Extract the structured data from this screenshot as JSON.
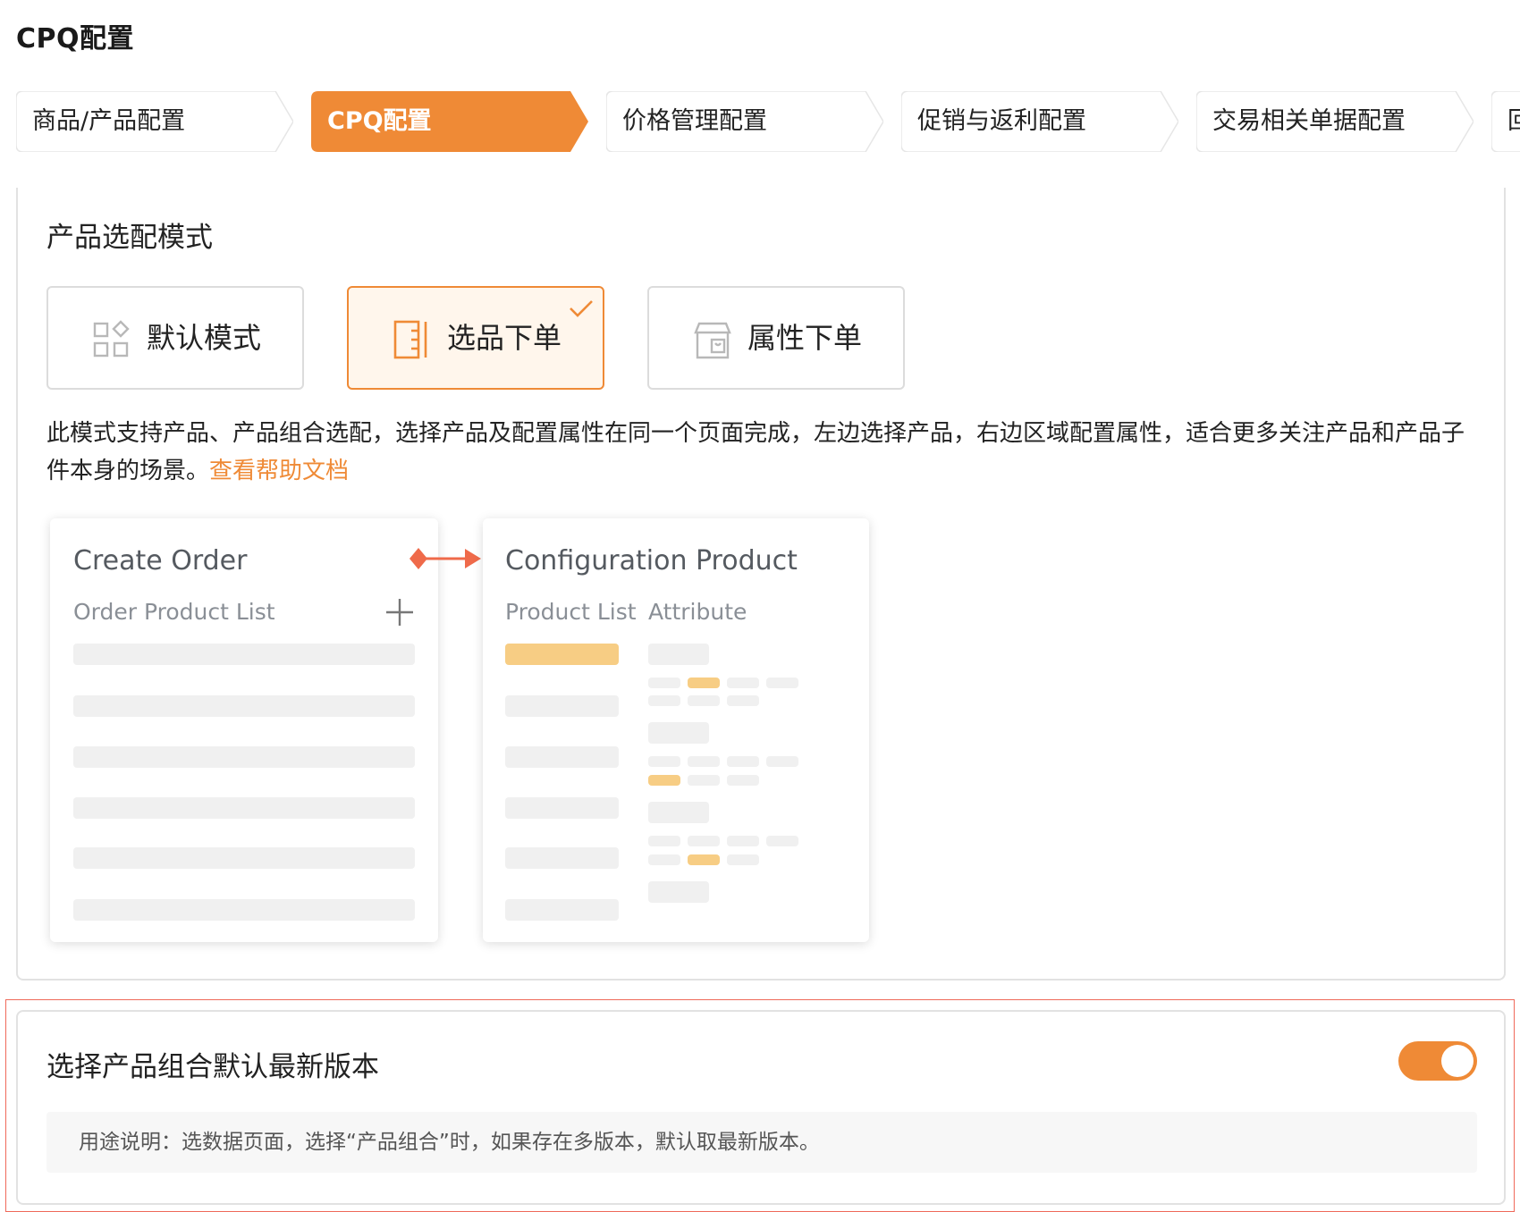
{
  "page_title": "CPQ配置",
  "steps": [
    {
      "label": "商品/产品配置",
      "active": false
    },
    {
      "label": "CPQ配置",
      "active": true
    },
    {
      "label": "价格管理配置",
      "active": false
    },
    {
      "label": "促销与返利配置",
      "active": false
    },
    {
      "label": "交易相关单据配置",
      "active": false
    },
    {
      "label": "回",
      "active": false
    }
  ],
  "selection_mode": {
    "title": "产品选配模式",
    "options": [
      {
        "label": "默认模式",
        "icon": "grid-icon",
        "selected": false
      },
      {
        "label": "选品下单",
        "icon": "list-panel-icon",
        "selected": true
      },
      {
        "label": "属性下单",
        "icon": "store-bag-icon",
        "selected": false
      }
    ],
    "description": "此模式支持产品、产品组合选配，选择产品及配置属性在同一个页面完成，左边选择产品，右边区域配置属性，适合更多关注产品和产品子件本身的场景。",
    "help_link": "查看帮助文档"
  },
  "illustration": {
    "left": {
      "title": "Create Order",
      "subtitle": "Order Product List"
    },
    "right": {
      "title": "Configuration Product",
      "tab_products": "Product List",
      "tab_attributes": "Attribute"
    }
  },
  "latest_version": {
    "title": "选择产品组合默认最新版本",
    "enabled": true,
    "usage": "用途说明：选数据页面，选择“产品组合”时，如果存在多版本，默认取最新版本。"
  },
  "colors": {
    "accent": "#ef8a36",
    "highlight_bar": "#f7cd84",
    "arrow": "#ef6a4a"
  }
}
